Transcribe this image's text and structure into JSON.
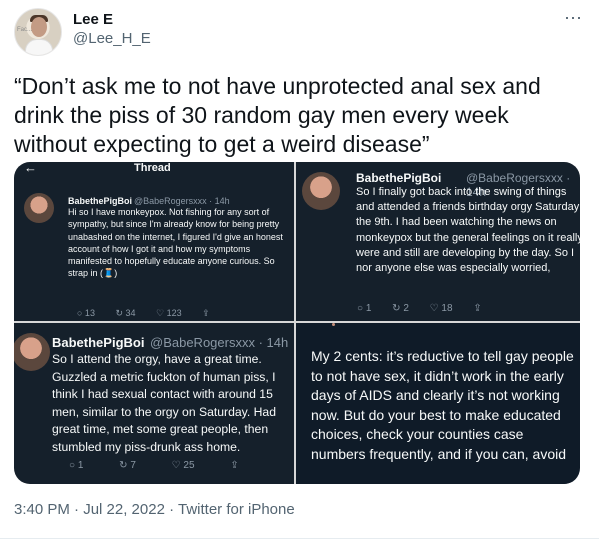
{
  "author": {
    "name": "Lee E",
    "handle": "@Lee_H_E"
  },
  "more_icon": "⋯",
  "tweet": {
    "text": "“Don’t ask me to not have unprotected anal sex and drink the piss of 30 random gay men every week without expecting to get a weird disease”"
  },
  "media": {
    "panel1": {
      "topbar_title": "Thread",
      "name": "BabethePigBoi",
      "handle": "@BabeRogersxxx · 14h",
      "text": "Hi so I have monkeypox. Not fishing for any sort of sympathy, but since I'm already know for being pretty unabashed on the internet, I figured I'd give an honest account of how I got it and how my symptoms manifested to hopefully educate anyone curious. So strap in (🧵)",
      "actions": [
        "○ 13",
        "↻ 34",
        "♡ 123",
        "⇪"
      ]
    },
    "panel2": {
      "name": "BabethePigBoi",
      "handle": "@BabeRogersxxx · 14h",
      "text": "So I finally got back into the swing of things and attended a friends birthday orgy Saturday the 9th. I had been watching the news on monkeypox but the general feelings on it really were and still are developing by the day. So I nor anyone else was especially worried,",
      "actions": [
        "○ 1",
        "↻ 2",
        "♡ 18",
        "⇪"
      ]
    },
    "panel3": {
      "name": "BabethePigBoi",
      "handle": "@BabeRogersxxx · 14h",
      "text": "So I attend the orgy, have a great time. Guzzled a metric fuckton of human piss, I think I had sexual contact with around 15 men, similar to the orgy on Saturday. Had great time, met some great people, then stumbled my piss-drunk ass home.",
      "actions": [
        "○ 1",
        "↻ 7",
        "♡ 25",
        "⇪"
      ]
    },
    "panel4": {
      "text": "My 2 cents: it’s reductive to tell gay people to not have sex, it didn’t work in the early days of AIDS and clearly it’s not working now. But do your best to make educated choices, check your counties case numbers frequently, and if you can, avoid"
    }
  },
  "timestamp": "3:40 PM · Jul 22, 2022 · Twitter for iPhone",
  "colors": {
    "text": "#0f1419",
    "secondary": "#536471",
    "dark_panel": "#15202b"
  }
}
